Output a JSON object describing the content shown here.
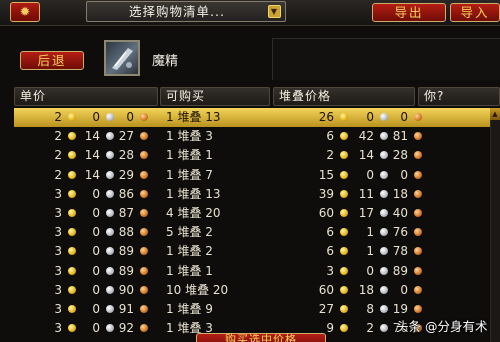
{
  "toolbar": {
    "gear_icon": "gear-icon",
    "dropdown_label": "选择购物清单...",
    "export_label": "导出",
    "import_label": "导入"
  },
  "item": {
    "back_label": "后退",
    "name": "魔精",
    "icon": "magic-dust-icon"
  },
  "columns": {
    "price": "单价",
    "buyable": "可购买",
    "stack_price": "堆叠价格",
    "you": "你?"
  },
  "rows": [
    {
      "pg": "2",
      "ps": "0",
      "pc": "0",
      "buy": "1 堆叠 13",
      "sg": "26",
      "ss": "0",
      "sc": "0",
      "selected": true
    },
    {
      "pg": "2",
      "ps": "14",
      "pc": "27",
      "buy": "1 堆叠 3",
      "sg": "6",
      "ss": "42",
      "sc": "81"
    },
    {
      "pg": "2",
      "ps": "14",
      "pc": "28",
      "buy": "1 堆叠 1",
      "sg": "2",
      "ss": "14",
      "sc": "28"
    },
    {
      "pg": "2",
      "ps": "14",
      "pc": "29",
      "buy": "1 堆叠 7",
      "sg": "15",
      "ss": "0",
      "sc": "0"
    },
    {
      "pg": "3",
      "ps": "0",
      "pc": "86",
      "buy": "1 堆叠 13",
      "sg": "39",
      "ss": "11",
      "sc": "18"
    },
    {
      "pg": "3",
      "ps": "0",
      "pc": "87",
      "buy": "4 堆叠 20",
      "sg": "60",
      "ss": "17",
      "sc": "40"
    },
    {
      "pg": "3",
      "ps": "0",
      "pc": "88",
      "buy": "5 堆叠 2",
      "sg": "6",
      "ss": "1",
      "sc": "76"
    },
    {
      "pg": "3",
      "ps": "0",
      "pc": "89",
      "buy": "1 堆叠 2",
      "sg": "6",
      "ss": "1",
      "sc": "78"
    },
    {
      "pg": "3",
      "ps": "0",
      "pc": "89",
      "buy": "1 堆叠 1",
      "sg": "3",
      "ss": "0",
      "sc": "89"
    },
    {
      "pg": "3",
      "ps": "0",
      "pc": "90",
      "buy": "10 堆叠 20",
      "sg": "60",
      "ss": "18",
      "sc": "0"
    },
    {
      "pg": "3",
      "ps": "0",
      "pc": "91",
      "buy": "1 堆叠 9",
      "sg": "27",
      "ss": "8",
      "sc": "19"
    },
    {
      "pg": "3",
      "ps": "0",
      "pc": "92",
      "buy": "1 堆叠 3",
      "sg": "9",
      "ss": "2",
      "sc": "76"
    }
  ],
  "bottom_button": "购买选中价格",
  "watermark": "头条 @分身有术",
  "colors": {
    "accent_red": "#b51e14",
    "accent_gold": "#f4d45a",
    "bg": "#0e0d0c"
  }
}
